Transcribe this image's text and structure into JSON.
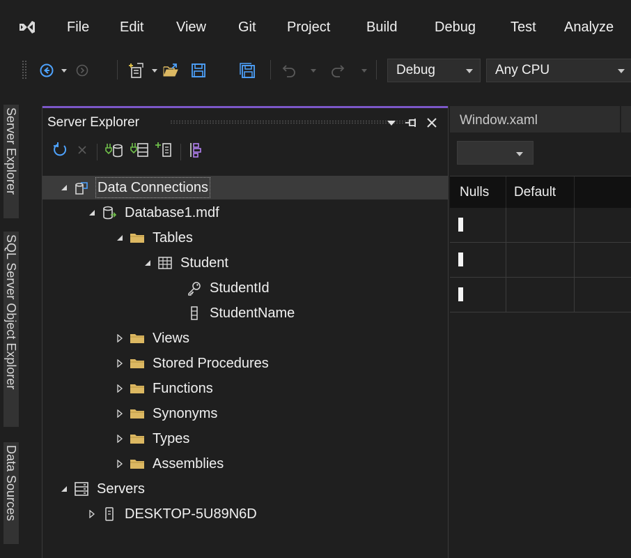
{
  "menu": {
    "items": [
      "File",
      "Edit",
      "View",
      "Git",
      "Project",
      "Build",
      "Debug",
      "Test",
      "Analyze"
    ]
  },
  "toolbar": {
    "configuration": "Debug",
    "platform": "Any CPU",
    "icons": [
      "back-icon",
      "dropdown-icon",
      "forward-icon",
      "new-project-icon",
      "open-icon",
      "save-icon",
      "save-all-icon",
      "undo-icon",
      "redo-icon"
    ]
  },
  "side_tabs": [
    "Server Explorer",
    "SQL Server Object Explorer",
    "Data Sources"
  ],
  "server_explorer": {
    "title": "Server Explorer",
    "toolbar_icons": [
      "refresh-icon",
      "stop-icon",
      "connect-to-database-icon",
      "connect-to-server-icon",
      "add-sharepoint-connection-icon",
      "connect-to-azure-icon"
    ],
    "tree": {
      "data_connections": "Data Connections",
      "database": "Database1.mdf",
      "tables": "Tables",
      "student": "Student",
      "student_id": "StudentId",
      "student_name": "StudentName",
      "views": "Views",
      "stored_procedures": "Stored Procedures",
      "functions": "Functions",
      "synonyms": "Synonyms",
      "types": "Types",
      "assemblies": "Assemblies",
      "servers": "Servers",
      "desktop": "DESKTOP-5U89N6D"
    }
  },
  "editor": {
    "tab_label": "Window.xaml",
    "grid_headers": [
      "Nulls",
      "Default"
    ]
  },
  "colors": {
    "accent": "#7b57c8",
    "folder": "#dcb862",
    "background": "#1f1f1f",
    "selection": "#3b3b3b"
  }
}
